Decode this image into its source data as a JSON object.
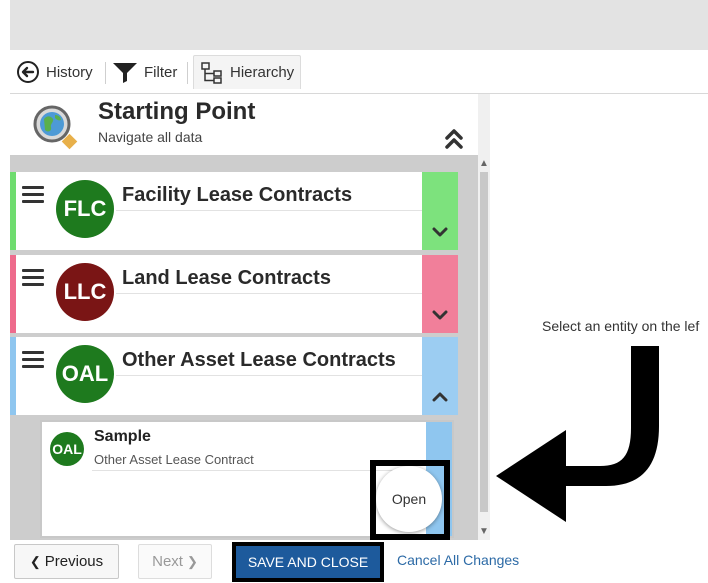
{
  "toolbar": {
    "history": "History",
    "filter": "Filter",
    "hierarchy": "Hierarchy"
  },
  "starting_point": {
    "title": "Starting Point",
    "subtitle": "Navigate all data"
  },
  "cards": [
    {
      "badge": "FLC",
      "title": "Facility Lease Contracts",
      "badge_color": "#1e7a1e",
      "stripe_color": "#6fdc6f",
      "band_color": "#7de27d"
    },
    {
      "badge": "LLC",
      "title": "Land Lease Contracts",
      "badge_color": "#7a1515",
      "stripe_color": "#ee6b8c",
      "band_color": "#f17f9a"
    },
    {
      "badge": "OAL",
      "title": "Other Asset Lease Contracts",
      "badge_color": "#1e7a1e",
      "stripe_color": "#8fc6ef",
      "band_color": "#9ccdf2"
    }
  ],
  "sample": {
    "badge": "OAL",
    "title": "Sample",
    "subtitle": "Other Asset Lease Contract"
  },
  "open_label": "Open",
  "right_message": "Select an entity on the lef",
  "bottom": {
    "previous": "Previous",
    "next": "Next",
    "save_close": "SAVE AND CLOSE",
    "cancel": "Cancel All Changes"
  },
  "colors": {
    "save_bg": "#1d5a9c",
    "link": "#2c6aa6"
  }
}
